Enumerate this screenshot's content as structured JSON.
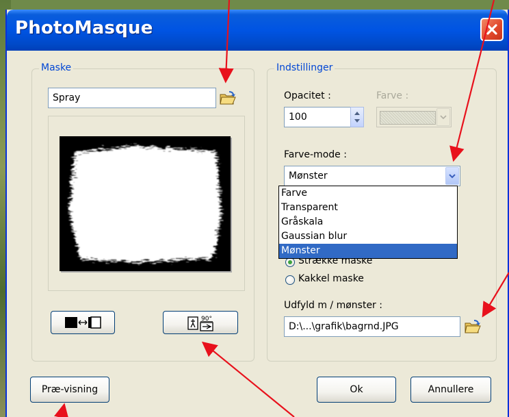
{
  "window": {
    "title": "PhotoMasque"
  },
  "mask_group": {
    "legend": "Maske",
    "mask_name": "Spray"
  },
  "settings_group": {
    "legend": "Indstillinger",
    "opacity_label": "Opacitet :",
    "opacity_value": "100",
    "color_label": "Farve :",
    "color_mode_label": "Farve-mode :",
    "color_mode_value": "Mønster",
    "color_mode_options": [
      "Farve",
      "Transparent",
      "Gråskala",
      "Gaussian blur",
      "Mønster"
    ],
    "color_mode_selected_index": 4,
    "radio_stretch": "Strække maske",
    "radio_tile": "Kakkel maske",
    "fill_label": "Udfyld m / mønster :",
    "fill_path": "D:\\...\\grafik\\bagrnd.JPG"
  },
  "buttons": {
    "preview": "Præ-visning",
    "ok": "Ok",
    "cancel": "Annullere",
    "rotate_badge": "90°"
  },
  "colors": {
    "titlebar": "#0054e3",
    "accent": "#0046d5",
    "selection": "#316ac5",
    "annotation_arrow": "#e8111c"
  }
}
